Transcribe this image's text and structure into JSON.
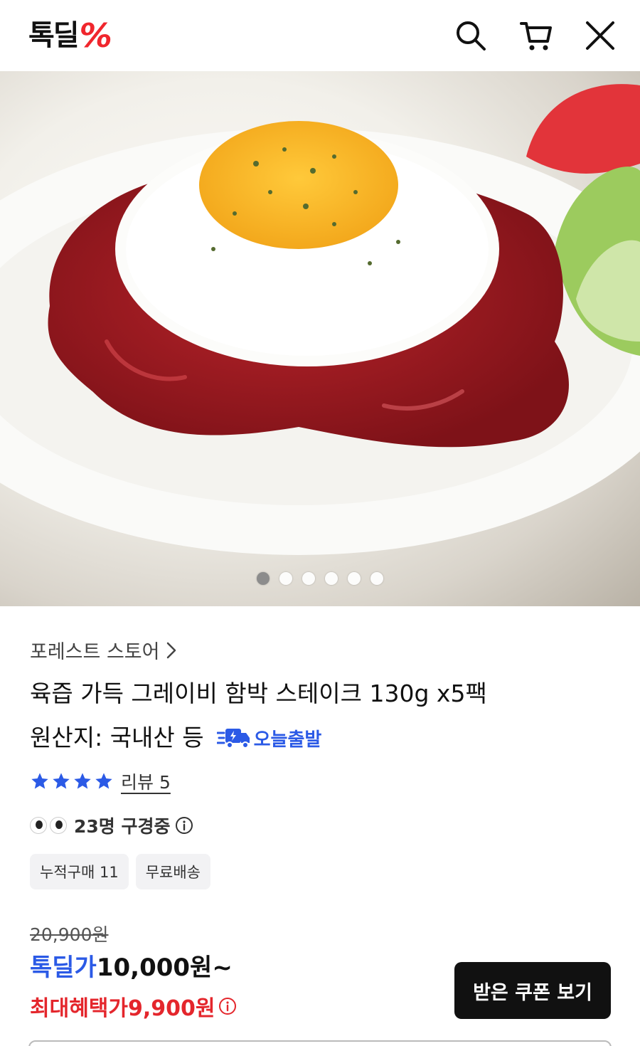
{
  "header": {
    "logo_text": "톡딜",
    "logo_mark": "%",
    "icons": [
      "search-icon",
      "cart-icon",
      "close-icon"
    ],
    "brand_color": "#f0262d"
  },
  "gallery": {
    "slide_count": 6,
    "active_index": 0
  },
  "product": {
    "store_name": "포레스트 스토어",
    "title": "육즙 가득 그레이비 함박 스테이크 130g x5팩",
    "origin": "원산지: 국내산 등",
    "shipping_badge": "오늘출발",
    "rating_stars": 4,
    "review_label": "리뷰 5",
    "viewers_label": "23명 구경중",
    "tags": [
      "누적구매 11",
      "무료배송"
    ]
  },
  "pricing": {
    "original_price": "20,900원",
    "deal_label": "톡딜가",
    "deal_price": "10,000원~",
    "max_label": "최대혜택가",
    "max_price": "9,900원",
    "accent_blue": "#2b5ae6",
    "accent_red": "#e4262c"
  },
  "actions": {
    "coupon_button": "받은 쿠폰 보기"
  }
}
